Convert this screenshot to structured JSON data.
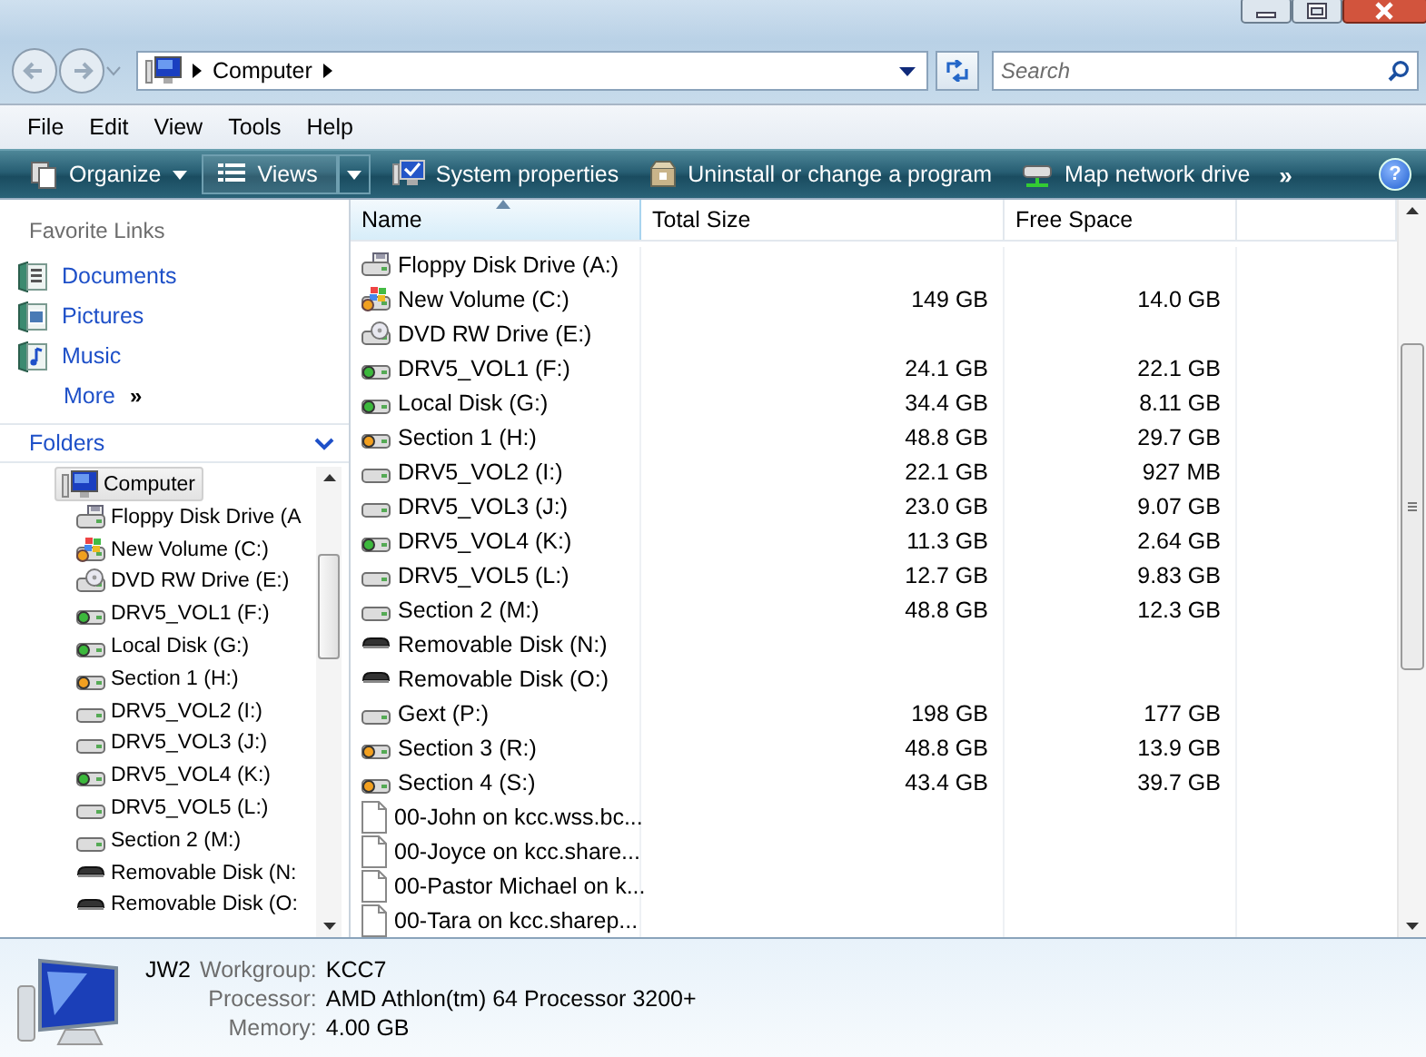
{
  "navigation": {
    "address": {
      "segments": [
        "Computer"
      ]
    },
    "search": {
      "placeholder": "Search"
    }
  },
  "menu": [
    "File",
    "Edit",
    "View",
    "Tools",
    "Help"
  ],
  "toolbar": {
    "buttons": [
      {
        "label": "Organize",
        "kind": "organize"
      },
      {
        "label": "Views",
        "kind": "views"
      },
      {
        "label": "System properties",
        "kind": "system"
      },
      {
        "label": "Uninstall or change a program",
        "kind": "uninstall"
      },
      {
        "label": "Map network drive",
        "kind": "map"
      }
    ],
    "overflow": "»",
    "help": "?"
  },
  "favorite_links": {
    "title": "Favorite Links",
    "items": [
      {
        "label": "Documents",
        "kind": "documents"
      },
      {
        "label": "Pictures",
        "kind": "pictures"
      },
      {
        "label": "Music",
        "kind": "music"
      }
    ],
    "more": "More",
    "more_arrow": "»"
  },
  "folders": {
    "title": "Folders",
    "tree": [
      {
        "label": "Computer",
        "kind": "computer",
        "selected": true,
        "children": [
          {
            "label": "Floppy Disk Drive (A",
            "kind": "floppy",
            "selected": false
          },
          {
            "label": "New Volume (C:)",
            "kind": "system",
            "selected": false
          },
          {
            "label": "DVD RW Drive (E:)",
            "kind": "dvd",
            "selected": false
          },
          {
            "label": "DRV5_VOL1 (F:)",
            "kind": "drive_green",
            "selected": false
          },
          {
            "label": "Local Disk (G:)",
            "kind": "drive_green",
            "selected": false
          },
          {
            "label": "Section 1 (H:)",
            "kind": "drive_orange",
            "selected": false
          },
          {
            "label": "DRV5_VOL2 (I:)",
            "kind": "drive",
            "selected": false
          },
          {
            "label": "DRV5_VOL3 (J:)",
            "kind": "drive",
            "selected": false
          },
          {
            "label": "DRV5_VOL4 (K:)",
            "kind": "drive_green",
            "selected": false
          },
          {
            "label": "DRV5_VOL5 (L:)",
            "kind": "drive",
            "selected": false
          },
          {
            "label": "Section 2 (M:)",
            "kind": "drive",
            "selected": false
          },
          {
            "label": "Removable Disk (N:",
            "kind": "removable",
            "selected": false
          },
          {
            "label": "Removable Disk (O:",
            "kind": "removable",
            "selected": false
          }
        ]
      }
    ]
  },
  "file_list": {
    "columns": [
      {
        "label": "Name",
        "sorted": true
      },
      {
        "label": "Total Size",
        "sorted": false
      },
      {
        "label": "Free Space",
        "sorted": false
      }
    ],
    "rows": [
      {
        "name": "Floppy Disk Drive (A:)",
        "kind": "floppy"
      },
      {
        "name": "New Volume (C:)",
        "kind": "system",
        "total_size": "149 GB",
        "free_space": "14.0 GB"
      },
      {
        "name": "DVD RW Drive (E:)",
        "kind": "dvd"
      },
      {
        "name": "DRV5_VOL1 (F:)",
        "kind": "drive_green",
        "total_size": "24.1 GB",
        "free_space": "22.1 GB"
      },
      {
        "name": "Local Disk (G:)",
        "kind": "drive_green",
        "total_size": "34.4 GB",
        "free_space": "8.11 GB"
      },
      {
        "name": "Section 1 (H:)",
        "kind": "drive_orange",
        "total_size": "48.8 GB",
        "free_space": "29.7 GB"
      },
      {
        "name": "DRV5_VOL2 (I:)",
        "kind": "drive",
        "total_size": "22.1 GB",
        "free_space": "927 MB"
      },
      {
        "name": "DRV5_VOL3 (J:)",
        "kind": "drive",
        "total_size": "23.0 GB",
        "free_space": "9.07 GB"
      },
      {
        "name": "DRV5_VOL4 (K:)",
        "kind": "drive_green",
        "total_size": "11.3 GB",
        "free_space": "2.64 GB"
      },
      {
        "name": "DRV5_VOL5 (L:)",
        "kind": "drive",
        "total_size": "12.7 GB",
        "free_space": "9.83 GB"
      },
      {
        "name": "Section 2 (M:)",
        "kind": "drive",
        "total_size": "48.8 GB",
        "free_space": "12.3 GB"
      },
      {
        "name": "Removable Disk (N:)",
        "kind": "removable"
      },
      {
        "name": "Removable Disk (O:)",
        "kind": "removable"
      },
      {
        "name": "Gext (P:)",
        "kind": "drive",
        "total_size": "198 GB",
        "free_space": "177 GB"
      },
      {
        "name": "Section 3 (R:)",
        "kind": "drive_orange",
        "total_size": "48.8 GB",
        "free_space": "13.9 GB"
      },
      {
        "name": "Section 4 (S:)",
        "kind": "drive_orange",
        "total_size": "43.4 GB",
        "free_space": "39.7 GB"
      },
      {
        "name": "00-John on kcc.wss.bc...",
        "kind": "document"
      },
      {
        "name": "00-Joyce on kcc.share...",
        "kind": "document"
      },
      {
        "name": "00-Pastor Michael on k...",
        "kind": "document"
      },
      {
        "name": "00-Tara on kcc.sharep...",
        "kind": "document"
      }
    ]
  },
  "details": {
    "name": "JW2",
    "fields": [
      {
        "label": "Workgroup:",
        "value": "KCC7"
      },
      {
        "label": "Processor:",
        "value": "AMD Athlon(tm) 64 Processor 3200+"
      },
      {
        "label": "Memory:",
        "value": "4.00 GB"
      }
    ]
  }
}
